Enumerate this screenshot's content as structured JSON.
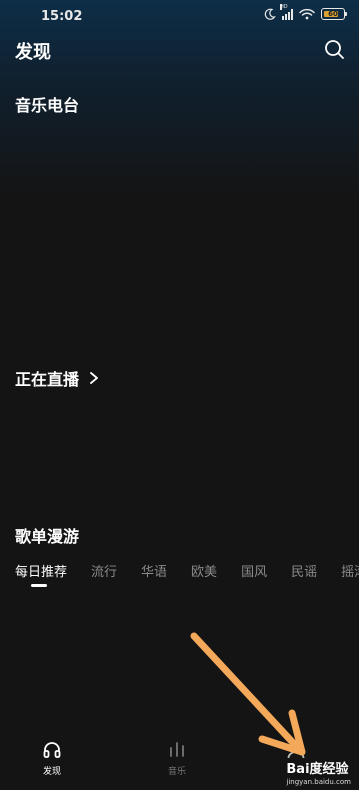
{
  "status_bar": {
    "time": "15:02",
    "network_label": "HD",
    "battery_level": "60",
    "battery_color": "#d9a12f"
  },
  "header": {
    "title": "发现",
    "search_icon": "search-icon"
  },
  "sections": {
    "radio": "音乐电台",
    "live": "正在直播",
    "playlist": "歌单漫游"
  },
  "tabs": [
    "每日推荐",
    "流行",
    "华语",
    "欧美",
    "国风",
    "民谣",
    "摇滚"
  ],
  "active_tab": 0,
  "bottom_nav": {
    "discover": "发现",
    "music": "音乐",
    "mine": ""
  },
  "watermark": {
    "brand": "Bai度经验",
    "url": "jingyan.baidu.com"
  },
  "colors": {
    "background": "#141414",
    "accent_arrow": "#f3a85a",
    "tab_inactive": "#8a8a8a"
  }
}
